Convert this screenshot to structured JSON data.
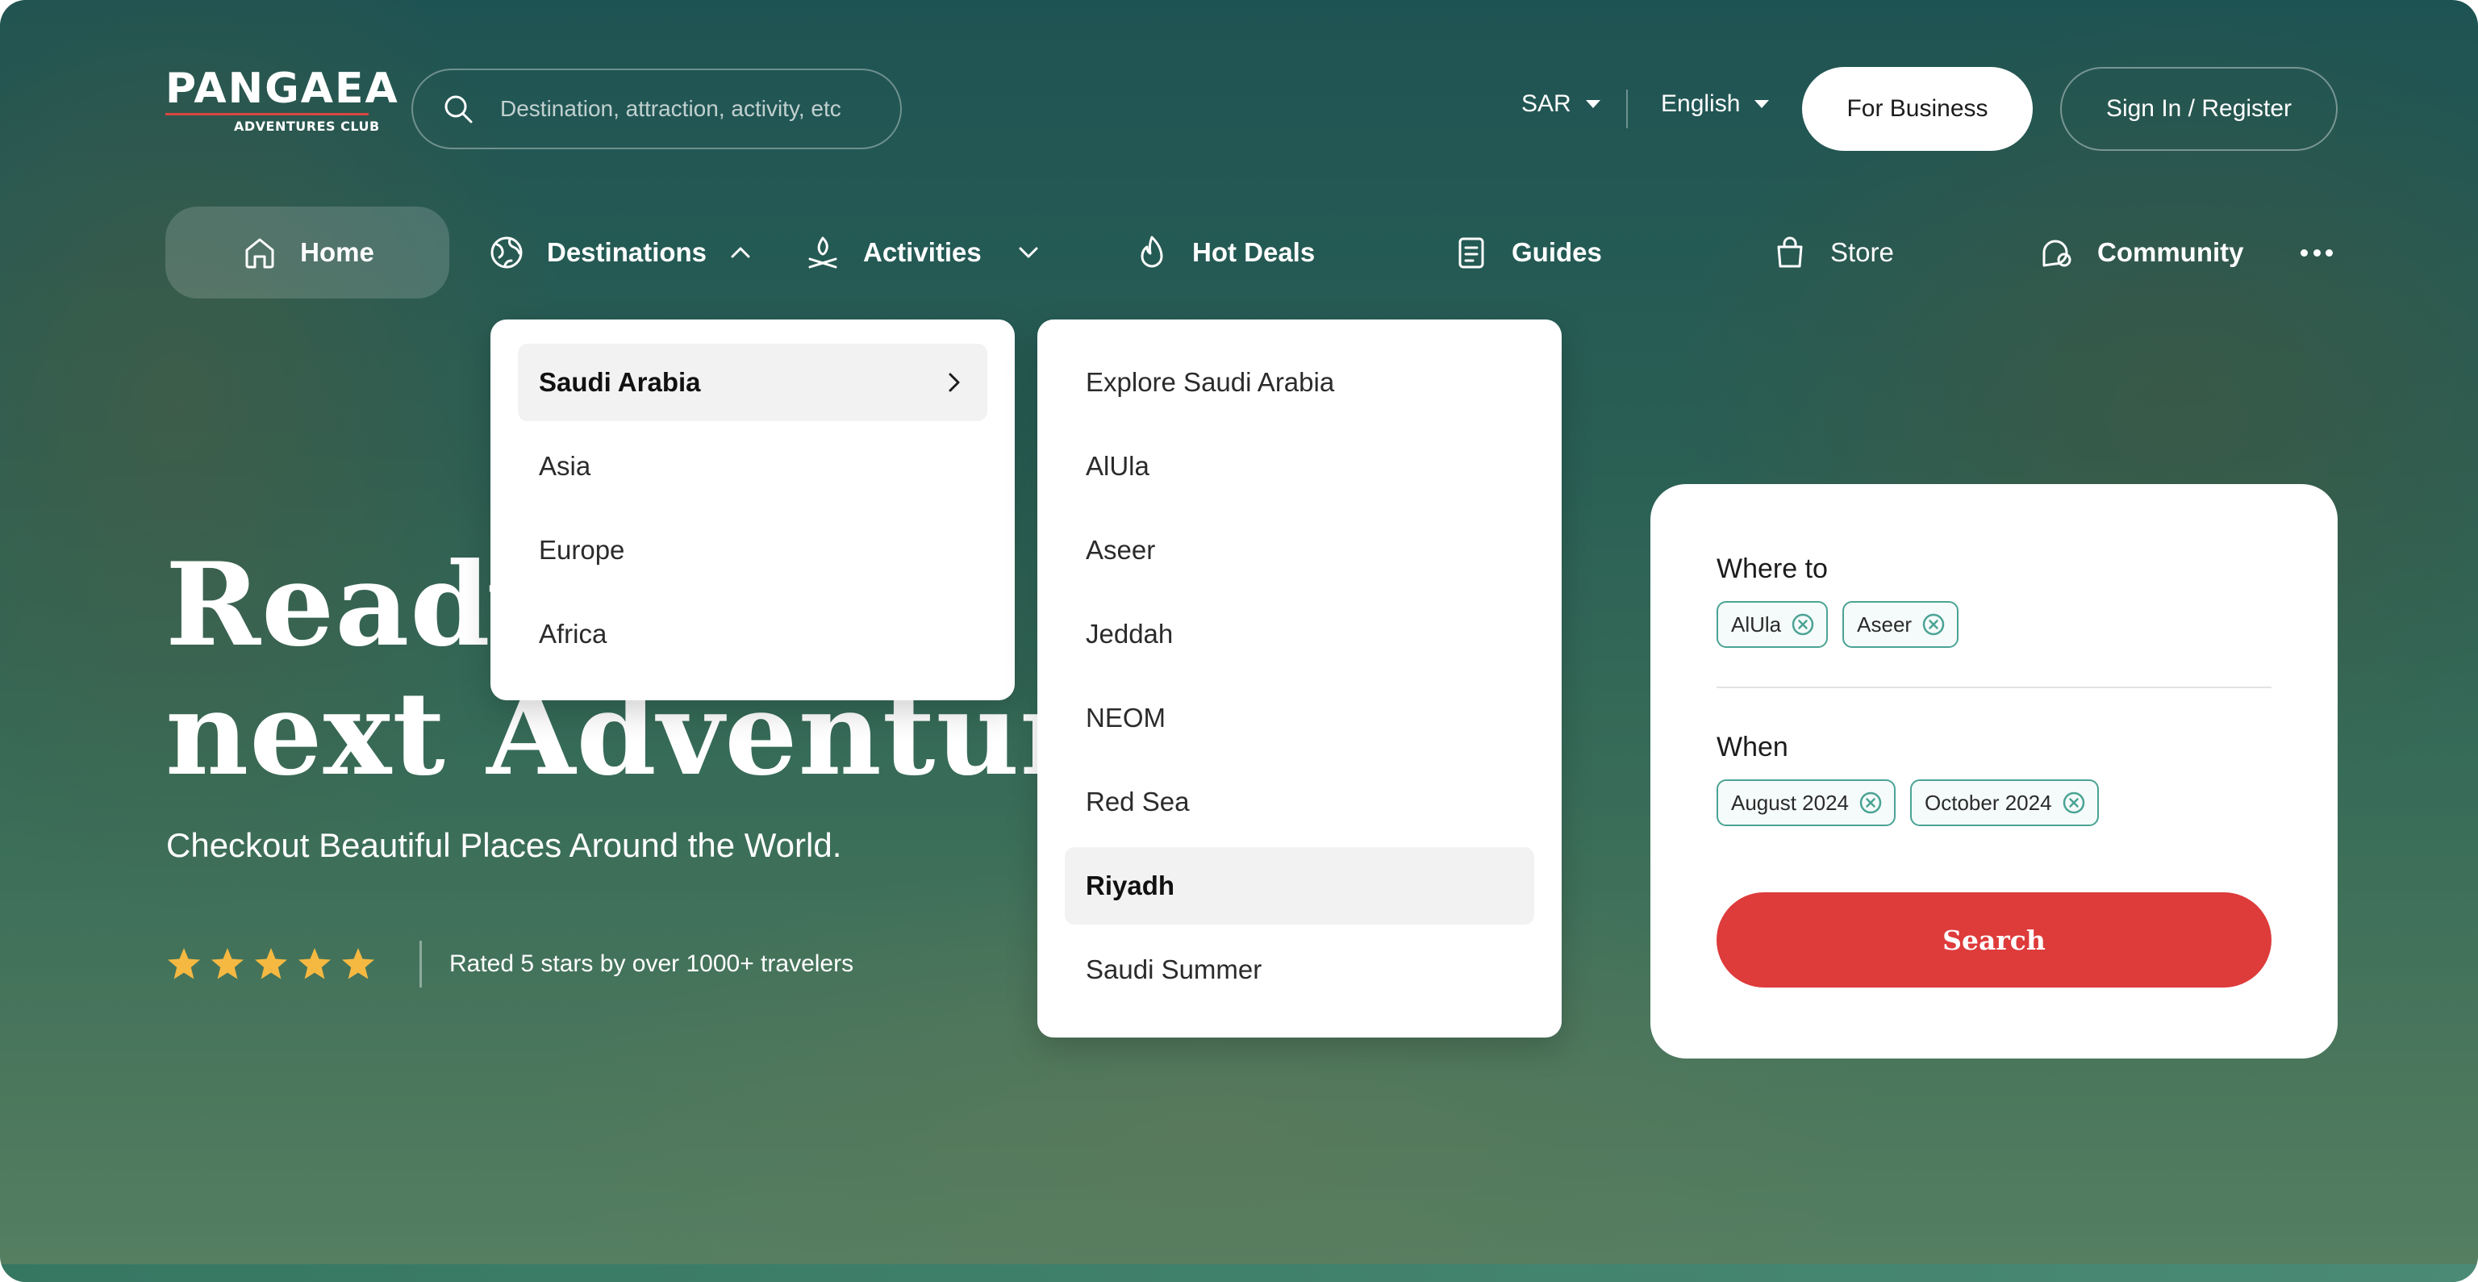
{
  "header": {
    "logo_text": "PANGAEA",
    "logo_subtext": "ADVENTURES CLUB",
    "search_placeholder": "Destination, attraction, activity, etc",
    "currency": "SAR",
    "language": "English",
    "business_label": "For Business",
    "signin_label": "Sign In / Register"
  },
  "nav": {
    "items": [
      {
        "label": "Home",
        "icon": "home-icon"
      },
      {
        "label": "Destinations",
        "icon": "globe-icon"
      },
      {
        "label": "Activities",
        "icon": "campfire-icon"
      },
      {
        "label": "Hot Deals",
        "icon": "flame-icon"
      },
      {
        "label": "Guides",
        "icon": "guide-book-icon"
      },
      {
        "label": "Store",
        "icon": "shopping-bag-icon"
      },
      {
        "label": "Community",
        "icon": "chat-bubble-icon"
      }
    ],
    "more_icon": "more-dots-icon"
  },
  "hero": {
    "title_line1": "Ready",
    "title_line2": "next Adventure",
    "subtitle": "Checkout Beautiful Places Around the World.",
    "rating_stars": 5,
    "rating_text": "Rated 5 stars by over 1000+ travelers"
  },
  "destinations_menu": {
    "regions": [
      "Saudi Arabia",
      "Asia",
      "Europe",
      "Africa"
    ],
    "active_region": "Saudi Arabia",
    "saudi_places": [
      "Explore Saudi Arabia",
      "AlUla",
      "Aseer",
      "Jeddah",
      "NEOM",
      "Red Sea",
      "Riyadh",
      "Saudi Summer"
    ],
    "active_place": "Riyadh"
  },
  "search_card": {
    "where_label": "Where to",
    "where_chips": [
      "AlUla",
      "Aseer"
    ],
    "when_label": "When",
    "when_chips": [
      "August 2024",
      "October 2024"
    ],
    "search_label": "Search"
  },
  "colors": {
    "accent_red": "#de3b3b",
    "chip_border": "#4aa394",
    "star": "#f5b942"
  }
}
